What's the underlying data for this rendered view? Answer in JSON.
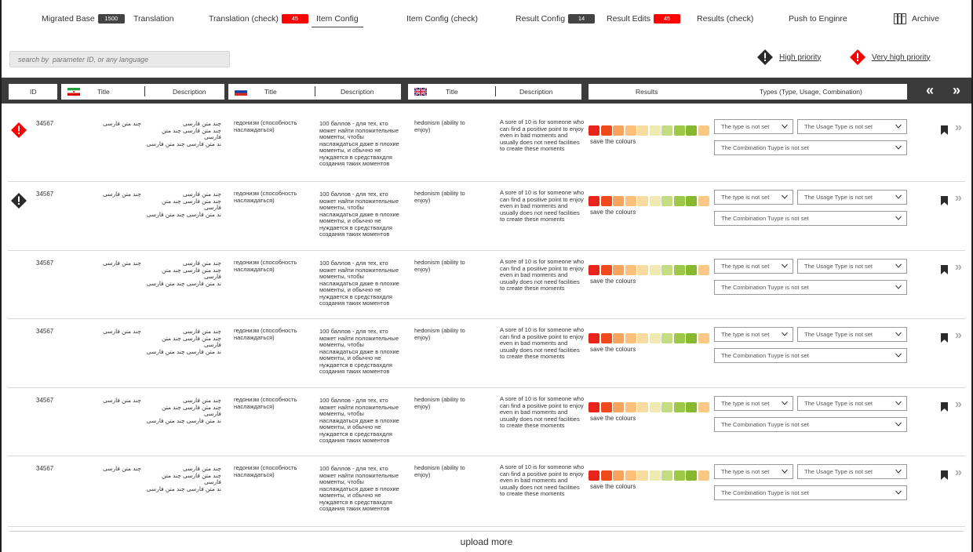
{
  "nav": {
    "tabs": [
      {
        "label": "Migrated Base",
        "badge": "1500",
        "badge_color": "dark"
      },
      {
        "label": "Translation",
        "badge": ""
      },
      {
        "label": "Translation (check)",
        "badge": "45",
        "badge_color": "red"
      },
      {
        "label": "Item Config",
        "badge": "",
        "active": true
      },
      {
        "label": "Item Config (check)",
        "badge": ""
      },
      {
        "label": "Result Config",
        "badge": "14",
        "badge_color": "dark"
      },
      {
        "label": "Result Edits",
        "badge": "45",
        "badge_color": "red"
      },
      {
        "label": "Results (check)",
        "badge": ""
      },
      {
        "label": "Push to Enginre",
        "badge": ""
      }
    ],
    "archive_label": "Archive"
  },
  "search": {
    "placeholder": "search by  parameter ID, or any language"
  },
  "legend": {
    "high": "High priority",
    "very_high": "Very high priority"
  },
  "header": {
    "id": "ID",
    "fa_title": "Title",
    "fa_desc": "Description",
    "ru_title": "Title",
    "ru_desc": "Description",
    "en_title": "Title",
    "en_desc": "Description",
    "results": "Results",
    "types": "Types (Type, Usage, Combination)"
  },
  "colors": {
    "accent_red": "#ff0000",
    "header_bg": "#3b3b3b",
    "swatches": [
      "#e8241a",
      "#f04a1c",
      "#f7a45e",
      "#fbc07a",
      "#f7dca0",
      "#eeeab2",
      "#c6dc83",
      "#9dc84a",
      "#88b830",
      "#f8c884"
    ]
  },
  "rows": [
    {
      "priority": "very-high",
      "id": "34567",
      "fa_title": "چند متن فارسی",
      "fa_desc_1": "چند متن فارسی",
      "fa_desc_2": "چند متن فارسی چند متن فارسی",
      "fa_desc_3": "ند متن فارسی چند متن فارسی",
      "ru_title": "гедонизм (способность наслаждаться)",
      "ru_desc": "100 баллов - для тех, кто может найти положительные моменты, чтобы наслаждаться даже в плохие моменты, и обычно не нуждается в средствахдля создания таких моментов",
      "en_title": "hedonism (ability to enjoy)",
      "en_desc": "A sore of 10 is for someone who can find a positive point to enjoy even in bad moments and usually does not need facilities to create these moments",
      "save": "save the colours",
      "type": "The type is not set",
      "usage": "The Usage Type is not set",
      "combination": "The Combination Tuype is not set"
    },
    {
      "priority": "high",
      "id": "34567",
      "fa_title": "چند متن فارسی",
      "fa_desc_1": "چند متن فارسی",
      "fa_desc_2": "چند متن فارسی چند متن فارسی",
      "fa_desc_3": "ند متن فارسی چند متن فارسی",
      "ru_title": "гедонизм (способность наслаждаться)",
      "ru_desc": "100 баллов - для тех, кто может найти положительные моменты, чтобы наслаждаться даже в плохие моменты, и обычно не нуждается в средствахдля создания таких моментов",
      "en_title": "hedonism (ability to enjoy)",
      "en_desc": "A sore of 10 is for someone who can find a positive point to enjoy even in bad moments and usually does not need facilities to create these moments",
      "save": "save the colours",
      "type": "The type is not set",
      "usage": "The Usage Type is not set",
      "combination": "The Combination Tuype is not set"
    },
    {
      "priority": "none",
      "id": "34567",
      "fa_title": "چند متن فارسی",
      "fa_desc_1": "چند متن فارسی",
      "fa_desc_2": "چند متن فارسی چند متن فارسی",
      "fa_desc_3": "ند متن فارسی چند متن فارسی",
      "ru_title": "гедонизм (способность наслаждаться)",
      "ru_desc": "100 баллов - для тех, кто может найти положительные моменты, чтобы наслаждаться даже в плохие моменты, и обычно не нуждается в средствахдля создания таких моментов",
      "en_title": "hedonism (ability to enjoy)",
      "en_desc": "A sore of 10 is for someone who can find a positive point to enjoy even in bad moments and usually does not need facilities to create these moments",
      "save": "save the colours",
      "type": "The type is not set",
      "usage": "The Usage Type is not set",
      "combination": "The Combination Tuype is not set"
    },
    {
      "priority": "none",
      "id": "34567",
      "fa_title": "چند متن فارسی",
      "fa_desc_1": "چند متن فارسی",
      "fa_desc_2": "چند متن فارسی چند متن فارسی",
      "fa_desc_3": "ند متن فارسی چند متن فارسی",
      "ru_title": "гедонизм (способность наслаждаться)",
      "ru_desc": "100 баллов - для тех, кто может найти положительные моменты, чтобы наслаждаться даже в плохие моменты, и обычно не нуждается в средствахдля создания таких моментов",
      "en_title": "hedonism (ability to enjoy)",
      "en_desc": "A sore of 10 is for someone who can find a positive point to enjoy even in bad moments and usually does not need facilities to create these moments",
      "save": "save the colours",
      "type": "The type is not set",
      "usage": "The Usage Type is not set",
      "combination": "The Combination Tuype is not set"
    },
    {
      "priority": "none",
      "id": "34567",
      "fa_title": "چند متن فارسی",
      "fa_desc_1": "چند متن فارسی",
      "fa_desc_2": "چند متن فارسی چند متن فارسی",
      "fa_desc_3": "ند متن فارسی چند متن فارسی",
      "ru_title": "гедонизм (способность наслаждаться)",
      "ru_desc": "100 баллов - для тех, кто может найти положительные моменты, чтобы наслаждаться даже в плохие моменты, и обычно не нуждается в средствахдля создания таких моментов",
      "en_title": "hedonism (ability to enjoy)",
      "en_desc": "A sore of 10 is for someone who can find a positive point to enjoy even in bad moments and usually does not need facilities to create these moments",
      "save": "save the colours",
      "type": "The type is not set",
      "usage": "The Usage Type is not set",
      "combination": "The Combination Tuype is not set"
    },
    {
      "priority": "none",
      "id": "34567",
      "fa_title": "چند متن فارسی",
      "fa_desc_1": "چند متن فارسی",
      "fa_desc_2": "چند متن فارسی چند متن فارسی",
      "fa_desc_3": "ند متن فارسی چند متن فارسی",
      "ru_title": "гедонизм (способность наслаждаться)",
      "ru_desc": "100 баллов - для тех, кто может найти положительные моменты, чтобы наслаждаться даже в плохие моменты, и обычно не нуждается в средствахдля создания таких моментов",
      "en_title": "hedonism (ability to enjoy)",
      "en_desc": "A sore of 10 is for someone who can find a positive point to enjoy even in bad moments and usually does not need facilities to create these moments",
      "save": "save the colours",
      "type": "The type is not set",
      "usage": "The Usage Type is not set",
      "combination": "The Combination Tuype is not set"
    }
  ],
  "footer": {
    "upload_more": "upload more"
  }
}
